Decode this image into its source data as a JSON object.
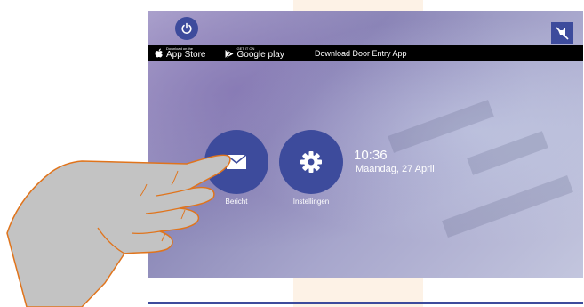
{
  "app_store": {
    "small": "Download on the",
    "big": "App Store"
  },
  "google_play": {
    "small": "GET IT ON",
    "big": "Google play"
  },
  "banner_text": "Download Door Entry App",
  "tiles": {
    "message_label": "Bericht",
    "settings_label": "Instellingen"
  },
  "clock": {
    "time": "10:36",
    "date": "Maandag, 27 April"
  },
  "icons": [
    "power-icon",
    "mute-icon",
    "apple-icon",
    "google-play-icon",
    "envelope-icon",
    "gear-icon"
  ],
  "colors": {
    "accent": "#3d4b9c",
    "banner": "#000000",
    "hand_outline": "#e0741c"
  }
}
